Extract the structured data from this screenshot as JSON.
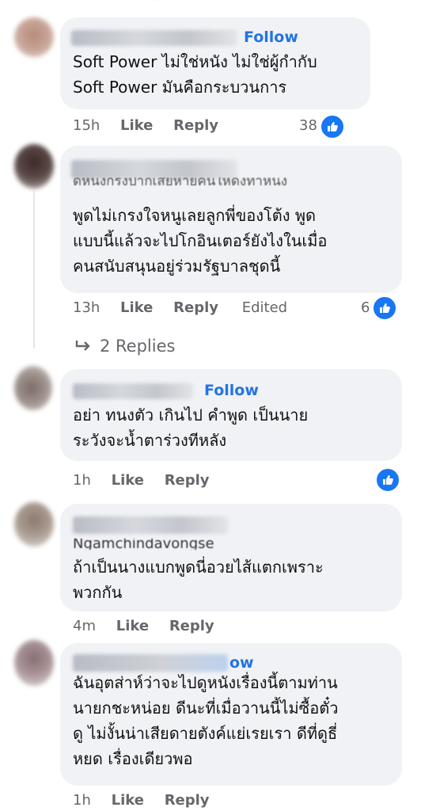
{
  "comments": [
    {
      "follow": "Follow",
      "lines": [
        "Soft Power ไม่ใช่หนัง ไม่ใช่ผู้กำกับ",
        "Soft Power มันคือกระบวนการ"
      ],
      "time": "15h",
      "like": "Like",
      "reply": "Reply",
      "reactions": "38"
    },
    {
      "lines": [
        "พูดไม่เกรงใจหนูเลยลูกพี่ของโต้ง พูด",
        "แบบนี้แล้วจะไปโกอินเตอร์ยังไงในเมื่อ",
        "คนสนับสนุนอยู่ร่วมรัฐบาลชุดนี้"
      ],
      "partial_line": "ดูหนังกรงปากเสียหายคนให้ดังทำหนัง",
      "time": "13h",
      "like": "Like",
      "reply": "Reply",
      "edited": "Edited",
      "reactions": "6",
      "replies": "2 Replies"
    },
    {
      "follow": "Follow",
      "lines": [
        "อย่า ทนงตัว เกินไป คำพูด เป็นนาย",
        "ระวังจะน้ำตาร่วงทีหลัง"
      ],
      "time": "1h",
      "like": "Like",
      "reply": "Reply"
    },
    {
      "name_partial": "Ngamchindavongse",
      "lines": [
        "ถ้าเป็นนางแบกพูดนี่อวยไส้แตกเพราะ",
        "พวกกัน"
      ],
      "time": "4m",
      "like": "Like",
      "reply": "Reply"
    },
    {
      "follow": "ow",
      "lines": [
        "ฉันอุตส่าห์ว่าจะไปดูหนังเรื่องนี้ตามท่าน",
        "นายกชะหน่อย ดีนะที่เมื่อวานนี้ไม่ซื้อตั๋ว",
        "ดู ไม่งั้นน่าเสียดายตังค์แย่เรยเรา ดีที่ดูธี่",
        "หยด เรื่องเดียวพอ"
      ],
      "time": "1h",
      "like": "Like",
      "reply": "Reply"
    }
  ],
  "icons": {
    "like": "thumbs-up-icon",
    "love": "heart-icon",
    "reply_arrow": "reply-arrow-icon"
  },
  "colors": {
    "bubble": "#f0f2f5",
    "link": "#2374e1",
    "meta": "#65676b",
    "like": "#1877f2",
    "love": "#f33e58"
  }
}
